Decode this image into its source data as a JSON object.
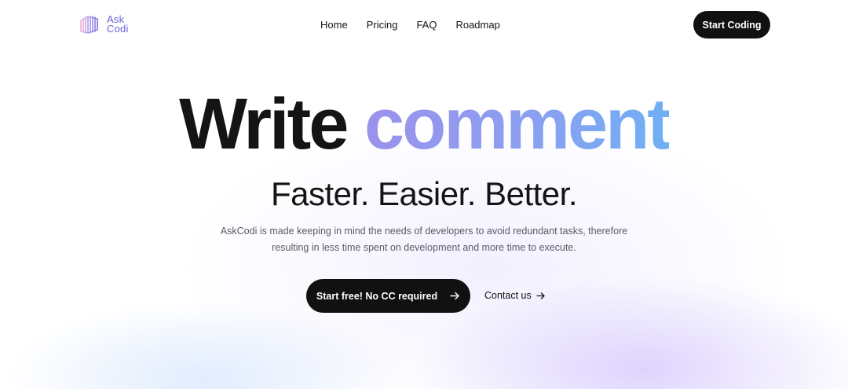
{
  "header": {
    "logo": {
      "line1": "Ask",
      "line2": "Codi"
    },
    "nav": [
      {
        "label": "Home"
      },
      {
        "label": "Pricing"
      },
      {
        "label": "FAQ"
      },
      {
        "label": "Roadmap"
      }
    ],
    "cta_label": "Start Coding"
  },
  "hero": {
    "headline_plain": "Write",
    "headline_gradient": "comment",
    "subheadline": "Faster. Easier. Better.",
    "description_line1": "AskCodi is made keeping in mind the needs of developers to avoid redundant tasks, therefore",
    "description_line2": "resulting in less time spent on development and more time to execute.",
    "primary_cta_label": "Start free! No CC required",
    "secondary_cta_label": "Contact us"
  },
  "icons": {
    "primary_cta": "arrow-right-icon",
    "secondary_cta": "arrow-right-icon",
    "logo": "askcodi-logo-icon"
  },
  "colors": {
    "accent_start": "#9a92ec",
    "accent_end": "#6fb0f5",
    "button_bg": "#111111",
    "logo_text": "#6a63d8"
  }
}
